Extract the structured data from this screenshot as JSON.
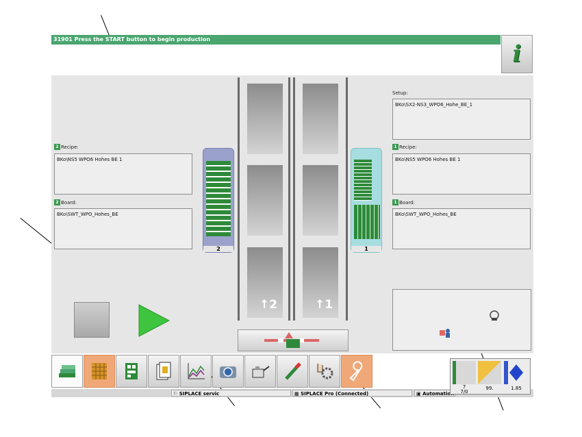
{
  "message_bar": {
    "text": "31901 Press the START button to begin production"
  },
  "info_button": {
    "label": "i"
  },
  "left_station": {
    "recipe_label": "Recipe:",
    "recipe_tag": "2",
    "recipe_value": "BKo\\NS5 WPO6 Hohes BE 1",
    "board_label": "Board:",
    "board_tag": "2",
    "board_value": "BKo\\SWT_WPO_Hohes_BE"
  },
  "right_station": {
    "setup_label": "Setup:",
    "setup_value": "BKo\\SX2-NS3_WPO6_Hohe_BE_1",
    "recipe_label": "Recipe:",
    "recipe_tag": "1",
    "recipe_value": "BKo\\NS5 WPO6 Hohes BE 1",
    "board_label": "Board:",
    "board_tag": "1",
    "board_value": "BKo\\SWT_WPO_Hohes_BE"
  },
  "magazines": {
    "left_number": "2",
    "right_number": "1"
  },
  "conveyor": {
    "lane_2_label": "2",
    "lane_1_label": "1"
  },
  "toolbar": {
    "buttons": [
      {
        "icon": "boards-stack-icon"
      },
      {
        "icon": "feeder-grid-icon"
      },
      {
        "icon": "board-layout-icon"
      },
      {
        "icon": "documents-icon"
      },
      {
        "icon": "chart-icon"
      },
      {
        "icon": "camera-icon"
      },
      {
        "icon": "oil-can-icon"
      },
      {
        "icon": "nozzle-icon"
      },
      {
        "icon": "hand-gear-icon"
      },
      {
        "icon": "wrench-icon"
      }
    ]
  },
  "status_bar": {
    "service": "SIPLACE servic",
    "connection": "SIPLACE Pro (Connected)",
    "automation": "Automation"
  },
  "status_widget": {
    "val1": "7",
    "val1b": "7/0",
    "val2": "99.",
    "val3": "1.85"
  },
  "colors": {
    "green_accent": "#4aa56f",
    "orange_active": "#f0a878",
    "panel_gray": "#e6e6e6"
  }
}
